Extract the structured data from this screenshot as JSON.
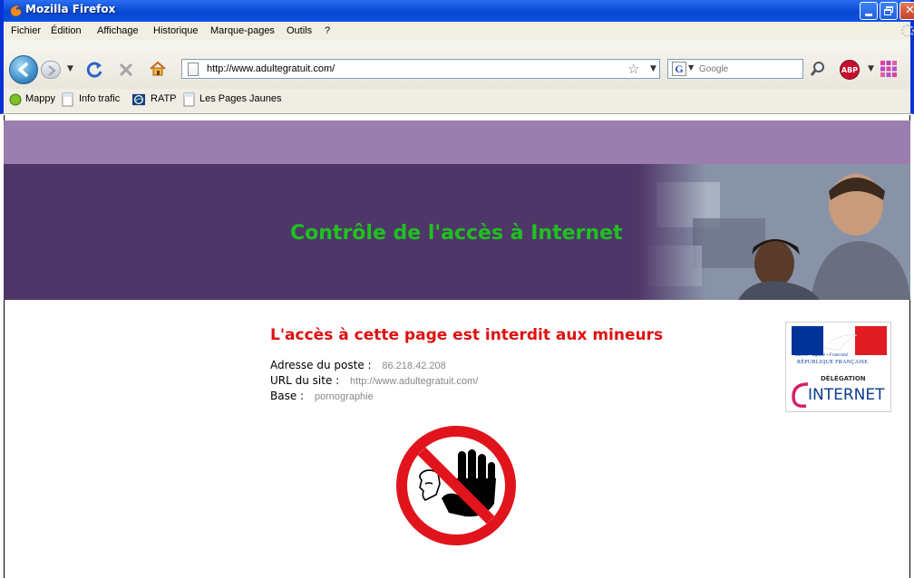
{
  "window": {
    "title": "Mozilla Firefox"
  },
  "menu": {
    "items": [
      "Fichier",
      "Édition",
      "Affichage",
      "Historique",
      "Marque-pages",
      "Outils",
      "?"
    ]
  },
  "navigation": {
    "url": "http://www.adultegratuit.com/",
    "search_placeholder": "Google",
    "search_engine_icon": "G",
    "adblock_label": "ABP"
  },
  "bookmarks": {
    "items": [
      {
        "label": "Mappy",
        "icon": "green-circle-icon"
      },
      {
        "label": "Info trafic",
        "icon": "page-icon"
      },
      {
        "label": "RATP",
        "icon": "ratp-icon"
      },
      {
        "label": "Les Pages Jaunes",
        "icon": "page-icon"
      }
    ]
  },
  "page": {
    "headline": "Contrôle de l'accès à Internet",
    "warning": "L'accès à cette page est interdit aux mineurs",
    "info": [
      {
        "label": "Adresse du poste :",
        "value": "86.218.42.208"
      },
      {
        "label": "URL du site :",
        "value": "http://www.adultegratuit.com/"
      },
      {
        "label": "Base :",
        "value": "pornographie"
      }
    ],
    "logo_rf": {
      "motto": "Liberté • Égalité • Fraternité",
      "name": "RÉPUBLIQUE FRANÇAISE"
    },
    "logo_di": {
      "top": "DÉLÉGATION",
      "bottom": "INTERNET"
    }
  },
  "colors": {
    "band_light": "#9a7fae",
    "band_dark": "#4f3668",
    "headline": "#1fc01f",
    "warning": "#e01010",
    "info_value": "#888888"
  }
}
